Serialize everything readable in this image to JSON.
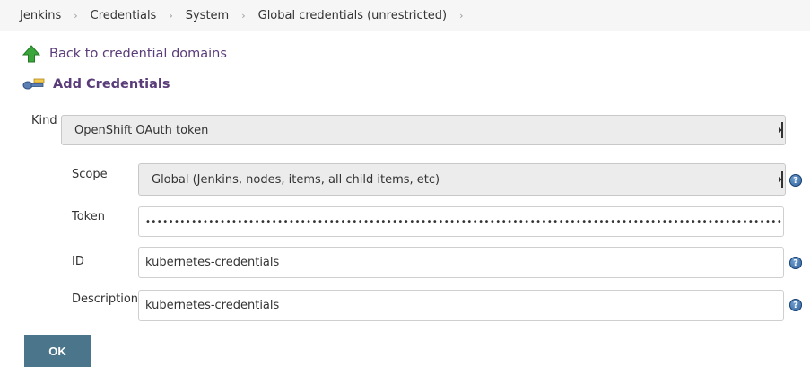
{
  "breadcrumb": {
    "items": [
      "Jenkins",
      "Credentials",
      "System",
      "Global credentials (unrestricted)"
    ],
    "separator": "›"
  },
  "back_link": {
    "label": "Back to credential domains",
    "icon": "up-arrow-icon"
  },
  "add_credentials": {
    "title": "Add Credentials",
    "icon": "key-icon"
  },
  "form": {
    "kind": {
      "label": "Kind",
      "value": "OpenShift OAuth token"
    },
    "scope": {
      "label": "Scope",
      "value": "Global (Jenkins, nodes, items, all child items, etc)"
    },
    "token": {
      "label": "Token",
      "value": "••••••••••••••••••••••••••••••••••••••••••••••••••••••••••••••••••••••••••••••••••••••••••••••••••••••••••••••••••••••••••••••••••••••••"
    },
    "id": {
      "label": "ID",
      "value": "kubernetes-credentials"
    },
    "description": {
      "label": "Description",
      "value": "kubernetes-credentials"
    },
    "help_icon": "?"
  },
  "ok_button": {
    "label": "OK"
  },
  "colors": {
    "link": "#5a3c7a",
    "button": "#4b758b",
    "breadcrumb_bg": "#f6f6f6"
  }
}
